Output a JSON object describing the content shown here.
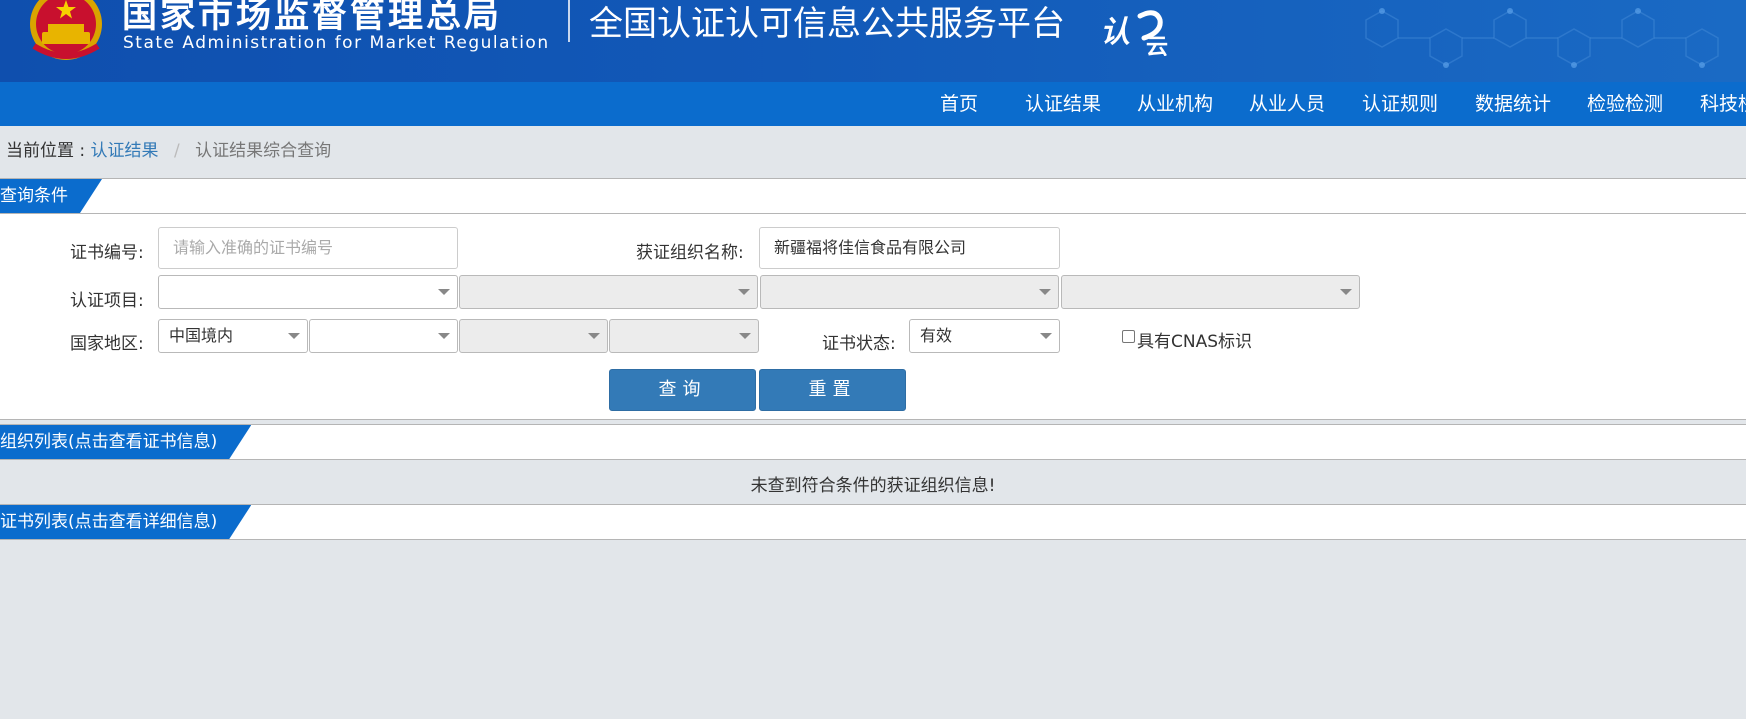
{
  "header": {
    "agency_cn": "国家市场监督管理总局",
    "agency_en": "State Administration  for  Market Regulation",
    "platform_title": "全国认证认可信息公共服务平台",
    "logo_text_main": "认",
    "logo_text_sub": "云",
    "colors": {
      "header_bg": "#1259b8",
      "nav_bg": "#0b6ccd",
      "accent": "#337ab7"
    }
  },
  "nav": {
    "items": [
      "首页",
      "认证结果",
      "从业机构",
      "从业人员",
      "认证规则",
      "数据统计",
      "检验检测",
      "科技桥"
    ]
  },
  "breadcrumb": {
    "prefix": "当前位置 : ",
    "link": "认证结果",
    "separator": "/",
    "current": "认证结果综合查询"
  },
  "query": {
    "section_title": "查询条件",
    "cert_no_label": "证书编号:",
    "cert_no_placeholder": "请输入准确的证书编号",
    "cert_no_value": "",
    "org_name_label": "获证组织名称:",
    "org_name_value": "新疆福将佳信食品有限公司",
    "project_label": "认证项目:",
    "project_selects": [
      "",
      "",
      "",
      ""
    ],
    "region_label": "国家地区:",
    "region_selects": [
      "中国境内",
      "",
      "",
      ""
    ],
    "status_label": "证书状态:",
    "status_value": "有效",
    "cnas_label": "具有CNAS标识",
    "cnas_checked": false,
    "search_button": "查询",
    "reset_button": "重置"
  },
  "org_list": {
    "section_title": "组织列表(点击查看证书信息)",
    "empty_message": "未查到符合条件的获证组织信息!"
  },
  "cert_list": {
    "section_title": "证书列表(点击查看详细信息)"
  }
}
